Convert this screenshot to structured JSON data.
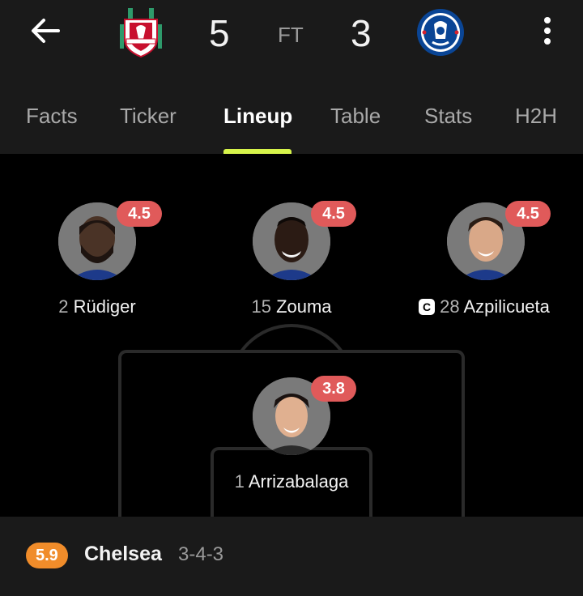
{
  "header": {
    "back_icon": "back-arrow-icon",
    "home_team_logo": "liverpool-crest",
    "away_team_logo": "chelsea-crest",
    "home_score": "5",
    "away_score": "3",
    "status": "FT",
    "menu_icon": "more-vertical-icon"
  },
  "tabs": [
    {
      "label": "Facts"
    },
    {
      "label": "Ticker"
    },
    {
      "label": "Lineup",
      "active": true
    },
    {
      "label": "Table"
    },
    {
      "label": "Stats"
    },
    {
      "label": "H2H"
    }
  ],
  "players": [
    {
      "number": "2",
      "name": "Rüdiger",
      "rating": "4.5",
      "captain": false
    },
    {
      "number": "15",
      "name": "Zouma",
      "rating": "4.5",
      "captain": false
    },
    {
      "number": "28",
      "name": "Azpilicueta",
      "rating": "4.5",
      "captain": true,
      "captain_label": "C"
    },
    {
      "number": "1",
      "name": "Arrizabalaga",
      "rating": "3.8",
      "captain": false
    }
  ],
  "footer": {
    "team_rating": "5.9",
    "team_name": "Chelsea",
    "formation": "3-4-3"
  },
  "colors": {
    "accent": "#d6f34a",
    "player_rating_badge": "#e05a5a",
    "team_rating_badge": "#f08c2a",
    "background": "#1a1a1a",
    "pitch": "#000000"
  }
}
